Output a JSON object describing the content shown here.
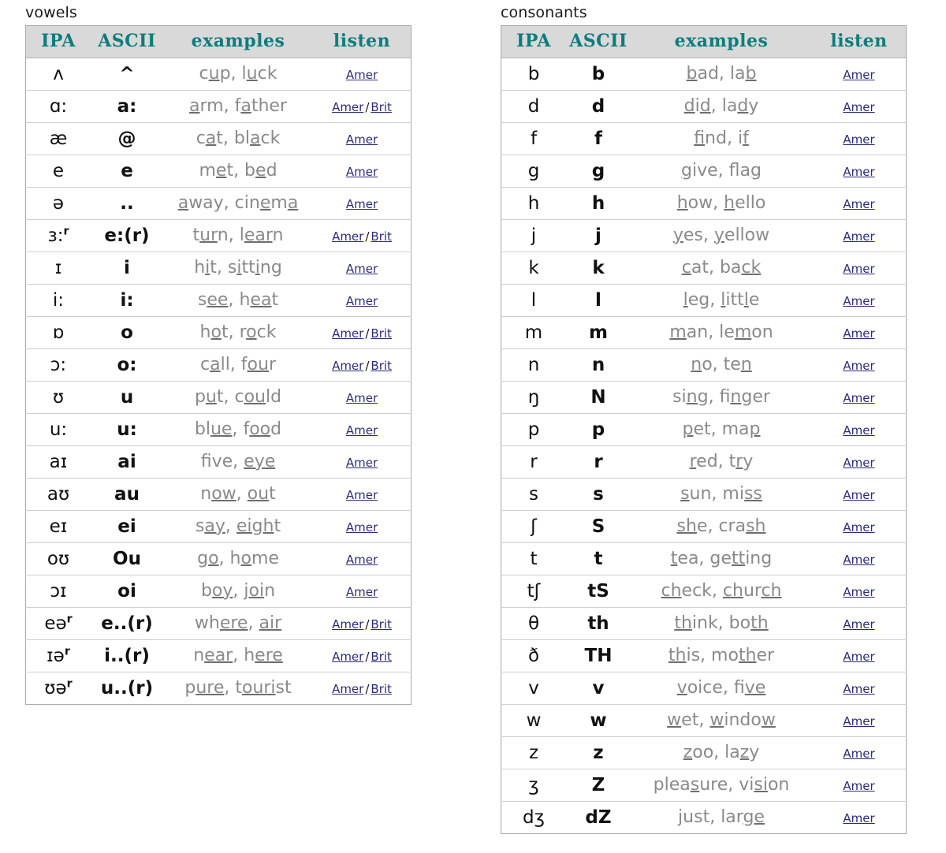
{
  "sections": {
    "vowels_label": "vowels",
    "consonants_label": "consonants"
  },
  "columns": {
    "ipa": "IPA",
    "ascii": "ASCII",
    "examples": "examples",
    "listen": "listen"
  },
  "links": {
    "amer": "Amer",
    "brit": "Brit",
    "separator": "/"
  },
  "colors": {
    "header_text": "#0d7d7d",
    "header_bg": "#d9d9d9",
    "examples_text": "#8a8a8a",
    "link": "#2b2b7a",
    "border": "#a8a8a8"
  },
  "vowels": [
    {
      "ipa": "ʌ",
      "ascii": "^",
      "examples_html": "c<u>u</u>p, l<u>u</u>ck",
      "listen": [
        "Amer"
      ]
    },
    {
      "ipa": "ɑ:",
      "ascii": "a:",
      "examples_html": "<u>a</u>rm, f<u>a</u>ther",
      "listen": [
        "Amer",
        "Brit"
      ]
    },
    {
      "ipa": "æ",
      "ascii": "@",
      "examples_html": "c<u>a</u>t, bl<u>a</u>ck",
      "listen": [
        "Amer"
      ]
    },
    {
      "ipa": "e",
      "ascii": "e",
      "examples_html": "m<u>e</u>t, b<u>e</u>d",
      "listen": [
        "Amer"
      ]
    },
    {
      "ipa": "ə",
      "ascii": "..",
      "examples_html": "<u>a</u>way, cin<u>e</u>m<u>a</u>",
      "listen": [
        "Amer"
      ]
    },
    {
      "ipa": "ɜ:ʳ",
      "ascii": "e:(r)",
      "examples_html": "t<u>ur</u>n, l<u>ear</u>n",
      "listen": [
        "Amer",
        "Brit"
      ]
    },
    {
      "ipa": "ɪ",
      "ascii": "i",
      "examples_html": "h<u>i</u>t, s<u>i</u>tt<u>i</u>ng",
      "listen": [
        "Amer"
      ]
    },
    {
      "ipa": "i:",
      "ascii": "i:",
      "examples_html": "s<u>ee</u>, h<u>ea</u>t",
      "listen": [
        "Amer"
      ]
    },
    {
      "ipa": "ɒ",
      "ascii": "o",
      "examples_html": "h<u>o</u>t, r<u>o</u>ck",
      "listen": [
        "Amer",
        "Brit"
      ]
    },
    {
      "ipa": "ɔ:",
      "ascii": "o:",
      "examples_html": "c<u>a</u>ll, f<u>ou</u>r",
      "listen": [
        "Amer",
        "Brit"
      ]
    },
    {
      "ipa": "ʊ",
      "ascii": "u",
      "examples_html": "p<u>u</u>t, c<u>ou</u>ld",
      "listen": [
        "Amer"
      ]
    },
    {
      "ipa": "u:",
      "ascii": "u:",
      "examples_html": "bl<u>ue</u>, f<u>oo</u>d",
      "listen": [
        "Amer"
      ]
    },
    {
      "ipa": "aɪ",
      "ascii": "ai",
      "examples_html": "f<u>i</u>ve, <u>eye</u>",
      "listen": [
        "Amer"
      ]
    },
    {
      "ipa": "aʊ",
      "ascii": "au",
      "examples_html": "n<u>ow</u>, <u>ou</u>t",
      "listen": [
        "Amer"
      ]
    },
    {
      "ipa": "eɪ",
      "ascii": "ei",
      "examples_html": "s<u>ay</u>, <u>eigh</u>t",
      "listen": [
        "Amer"
      ]
    },
    {
      "ipa": "oʊ",
      "ascii": "Ou",
      "examples_html": "g<u>o</u>, h<u>o</u>me",
      "listen": [
        "Amer"
      ]
    },
    {
      "ipa": "ɔɪ",
      "ascii": "oi",
      "examples_html": "b<u>oy</u>, j<u>oi</u>n",
      "listen": [
        "Amer"
      ]
    },
    {
      "ipa": "eəʳ",
      "ascii": "e..(r)",
      "examples_html": "wh<u>ere</u>, <u>air</u>",
      "listen": [
        "Amer",
        "Brit"
      ]
    },
    {
      "ipa": "ɪəʳ",
      "ascii": "i..(r)",
      "examples_html": "n<u>ear</u>, h<u>ere</u>",
      "listen": [
        "Amer",
        "Brit"
      ]
    },
    {
      "ipa": "ʊəʳ",
      "ascii": "u..(r)",
      "examples_html": "p<u>ure</u>, t<u>ouri</u>st",
      "listen": [
        "Amer",
        "Brit"
      ]
    }
  ],
  "consonants": [
    {
      "ipa": "b",
      "ascii": "b",
      "examples_html": "<u>b</u>ad, la<u>b</u>",
      "listen": [
        "Amer"
      ]
    },
    {
      "ipa": "d",
      "ascii": "d",
      "examples_html": "<u>d</u>i<u>d</u>, la<u>d</u>y",
      "listen": [
        "Amer"
      ]
    },
    {
      "ipa": "f",
      "ascii": "f",
      "examples_html": "<u>f</u>ind, i<u>f</u>",
      "listen": [
        "Amer"
      ]
    },
    {
      "ipa": "g",
      "ascii": "g",
      "examples_html": "<u>g</u>ive, fla<u>g</u>",
      "listen": [
        "Amer"
      ]
    },
    {
      "ipa": "h",
      "ascii": "h",
      "examples_html": "<u>h</u>ow, <u>h</u>ello",
      "listen": [
        "Amer"
      ]
    },
    {
      "ipa": "j",
      "ascii": "j",
      "examples_html": "<u>y</u>es, <u>y</u>ellow",
      "listen": [
        "Amer"
      ]
    },
    {
      "ipa": "k",
      "ascii": "k",
      "examples_html": "<u>c</u>at, ba<u>ck</u>",
      "listen": [
        "Amer"
      ]
    },
    {
      "ipa": "l",
      "ascii": "l",
      "examples_html": "<u>l</u>eg, <u>l</u>itt<u>l</u>e",
      "listen": [
        "Amer"
      ]
    },
    {
      "ipa": "m",
      "ascii": "m",
      "examples_html": "<u>m</u>an, le<u>m</u>on",
      "listen": [
        "Amer"
      ]
    },
    {
      "ipa": "n",
      "ascii": "n",
      "examples_html": "<u>n</u>o, te<u>n</u>",
      "listen": [
        "Amer"
      ]
    },
    {
      "ipa": "ŋ",
      "ascii": "N",
      "examples_html": "si<u>ng</u>, fi<u>n</u>ger",
      "listen": [
        "Amer"
      ]
    },
    {
      "ipa": "p",
      "ascii": "p",
      "examples_html": "<u>p</u>et, ma<u>p</u>",
      "listen": [
        "Amer"
      ]
    },
    {
      "ipa": "r",
      "ascii": "r",
      "examples_html": "<u>r</u>ed, t<u>r</u>y",
      "listen": [
        "Amer"
      ]
    },
    {
      "ipa": "s",
      "ascii": "s",
      "examples_html": "<u>s</u>un, mi<u>ss</u>",
      "listen": [
        "Amer"
      ]
    },
    {
      "ipa": "ʃ",
      "ascii": "S",
      "examples_html": "<u>sh</u>e, cra<u>sh</u>",
      "listen": [
        "Amer"
      ]
    },
    {
      "ipa": "t",
      "ascii": "t",
      "examples_html": "<u>t</u>ea, ge<u>tt</u>ing",
      "listen": [
        "Amer"
      ]
    },
    {
      "ipa": "tʃ",
      "ascii": "tS",
      "examples_html": "<u>ch</u>eck, <u>ch</u>ur<u>ch</u>",
      "listen": [
        "Amer"
      ]
    },
    {
      "ipa": "θ",
      "ascii": "th",
      "examples_html": "<u>th</u>ink, bo<u>th</u>",
      "listen": [
        "Amer"
      ]
    },
    {
      "ipa": "ð",
      "ascii": "TH",
      "examples_html": "<u>th</u>is, mo<u>th</u>er",
      "listen": [
        "Amer"
      ]
    },
    {
      "ipa": "v",
      "ascii": "v",
      "examples_html": "<u>v</u>oice, fi<u>ve</u>",
      "listen": [
        "Amer"
      ]
    },
    {
      "ipa": "w",
      "ascii": "w",
      "examples_html": "<u>w</u>et, <u>w</u>indo<u>w</u>",
      "listen": [
        "Amer"
      ]
    },
    {
      "ipa": "z",
      "ascii": "z",
      "examples_html": "<u>z</u>oo, la<u>z</u>y",
      "listen": [
        "Amer"
      ]
    },
    {
      "ipa": "ʒ",
      "ascii": "Z",
      "examples_html": "plea<u>s</u>ure, vi<u>si</u>on",
      "listen": [
        "Amer"
      ]
    },
    {
      "ipa": "dʒ",
      "ascii": "dZ",
      "examples_html": "<u>j</u>ust, lar<u>ge</u>",
      "listen": [
        "Amer"
      ]
    }
  ]
}
